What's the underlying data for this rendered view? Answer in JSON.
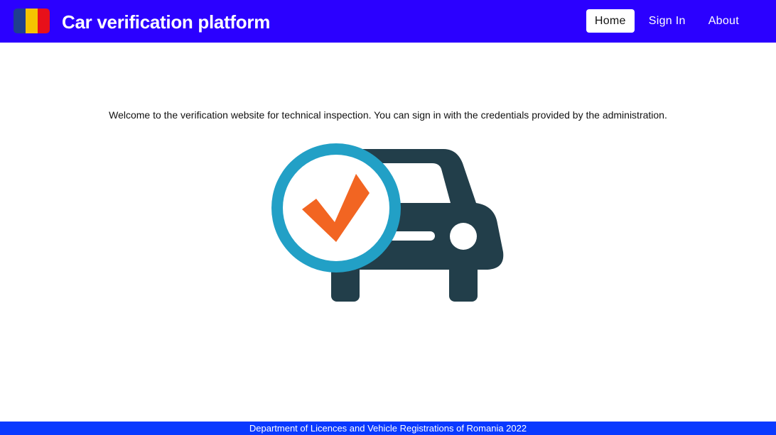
{
  "header": {
    "title": "Car verification platform",
    "flag_colors": [
      "#1f3f8f",
      "#f5c400",
      "#e8101a"
    ],
    "nav": [
      {
        "label": "Home",
        "active": true
      },
      {
        "label": "Sign In",
        "active": false
      },
      {
        "label": "About",
        "active": false
      }
    ],
    "background": "#2b00ff"
  },
  "main": {
    "welcome_text": "Welcome to the verification website for technical inspection. You can sign in with the credentials provided by the administration.",
    "hero_icon": "car-verified-icon",
    "colors": {
      "car": "#223e4a",
      "badge_ring": "#22a0c6",
      "check": "#f26522"
    }
  },
  "footer": {
    "text": "Department of Licences and Vehicle Registrations of Romania 2022",
    "background": "#0a39ff"
  }
}
